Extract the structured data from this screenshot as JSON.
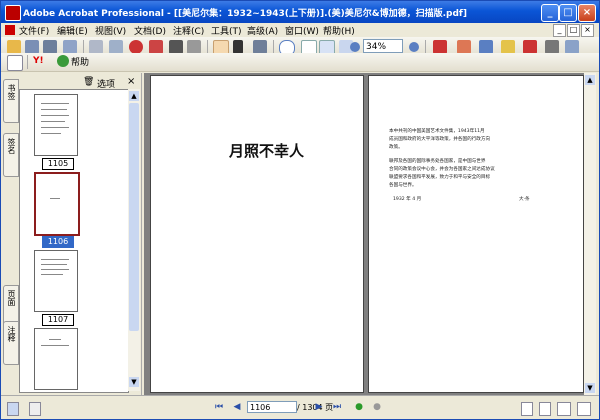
{
  "window": {
    "title": "Adobe Acrobat Professional - [[美尼尔集：1932~1943(上下册)].(美)美尼尔&博加德，扫描版.pdf]"
  },
  "menus": [
    "文件(F)",
    "编辑(E)",
    "视图(V)",
    "文档(D)",
    "注释(C)",
    "工具(T)",
    "高级(A)",
    "窗口(W)",
    "帮助(H)"
  ],
  "toolbar": {
    "zoom_value": "34%",
    "help_label": "帮助",
    "search_label": "Y!"
  },
  "nav_panel": {
    "options_label": "选项",
    "tabs": [
      "书签",
      "签名",
      "页面",
      "注释"
    ],
    "thumbnails": [
      {
        "label": "1105",
        "selected": false
      },
      {
        "label": "1106",
        "selected": true
      },
      {
        "label": "1107",
        "selected": false
      },
      {
        "label": "",
        "selected": false
      }
    ]
  },
  "document": {
    "left_page_title": "月照不幸人",
    "right_page_lines": [
      "本中共刊的中国美国艺术文件集，1943年11月",
      "成员国和政府的大平洋等政策，并各国的行政方向",
      "政策。",
      "联邦及各国的国际事务处各国家，是中国与世界",
      "合同的政策会议中心会，并会为各国家之间达成协议",
      "联盟要求各国和平发展，致力于和平与安全的目标",
      "各国与世界。"
    ],
    "right_page_date": "1932 年 4 月",
    "right_page_signature": "大·条"
  },
  "statusbar": {
    "current_page": "1106",
    "total_pages": "/ 1304 页"
  }
}
